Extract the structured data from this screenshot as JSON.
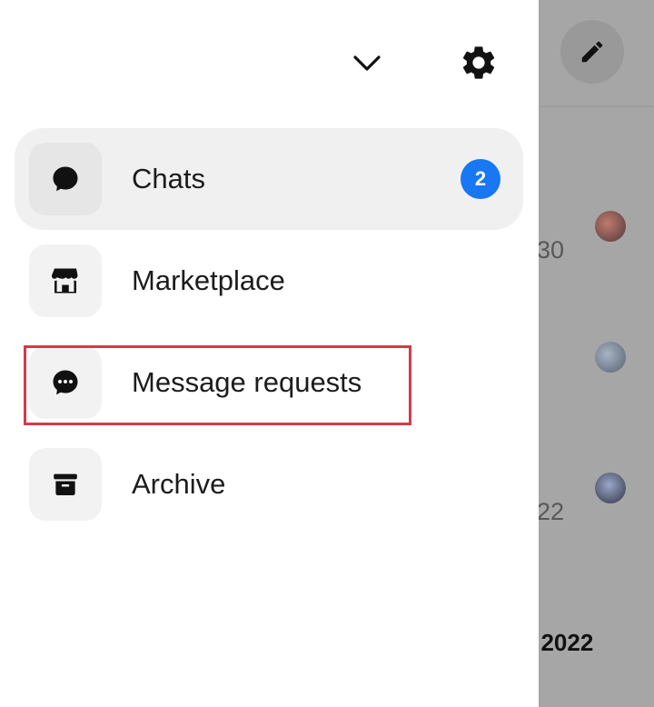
{
  "drawer": {
    "icons": {
      "collapse": "chevron-down-icon",
      "settings": "gear-icon"
    },
    "menu": [
      {
        "label": "Chats",
        "icon": "chat-bubble-icon",
        "badge": "2",
        "active": true
      },
      {
        "label": "Marketplace",
        "icon": "storefront-icon"
      },
      {
        "label": "Message requests",
        "icon": "message-dots-icon",
        "highlighted": true
      },
      {
        "label": "Archive",
        "icon": "archive-box-icon"
      }
    ]
  },
  "background": {
    "compose_icon": "pencil-icon",
    "peek_texts": [
      "30",
      "22"
    ],
    "peek_date": ", 2022"
  },
  "colors": {
    "badge": "#1877f2",
    "highlight_border": "#d63a47",
    "overlay": "#a6a6a6",
    "active_row": "#f0f0f0"
  }
}
